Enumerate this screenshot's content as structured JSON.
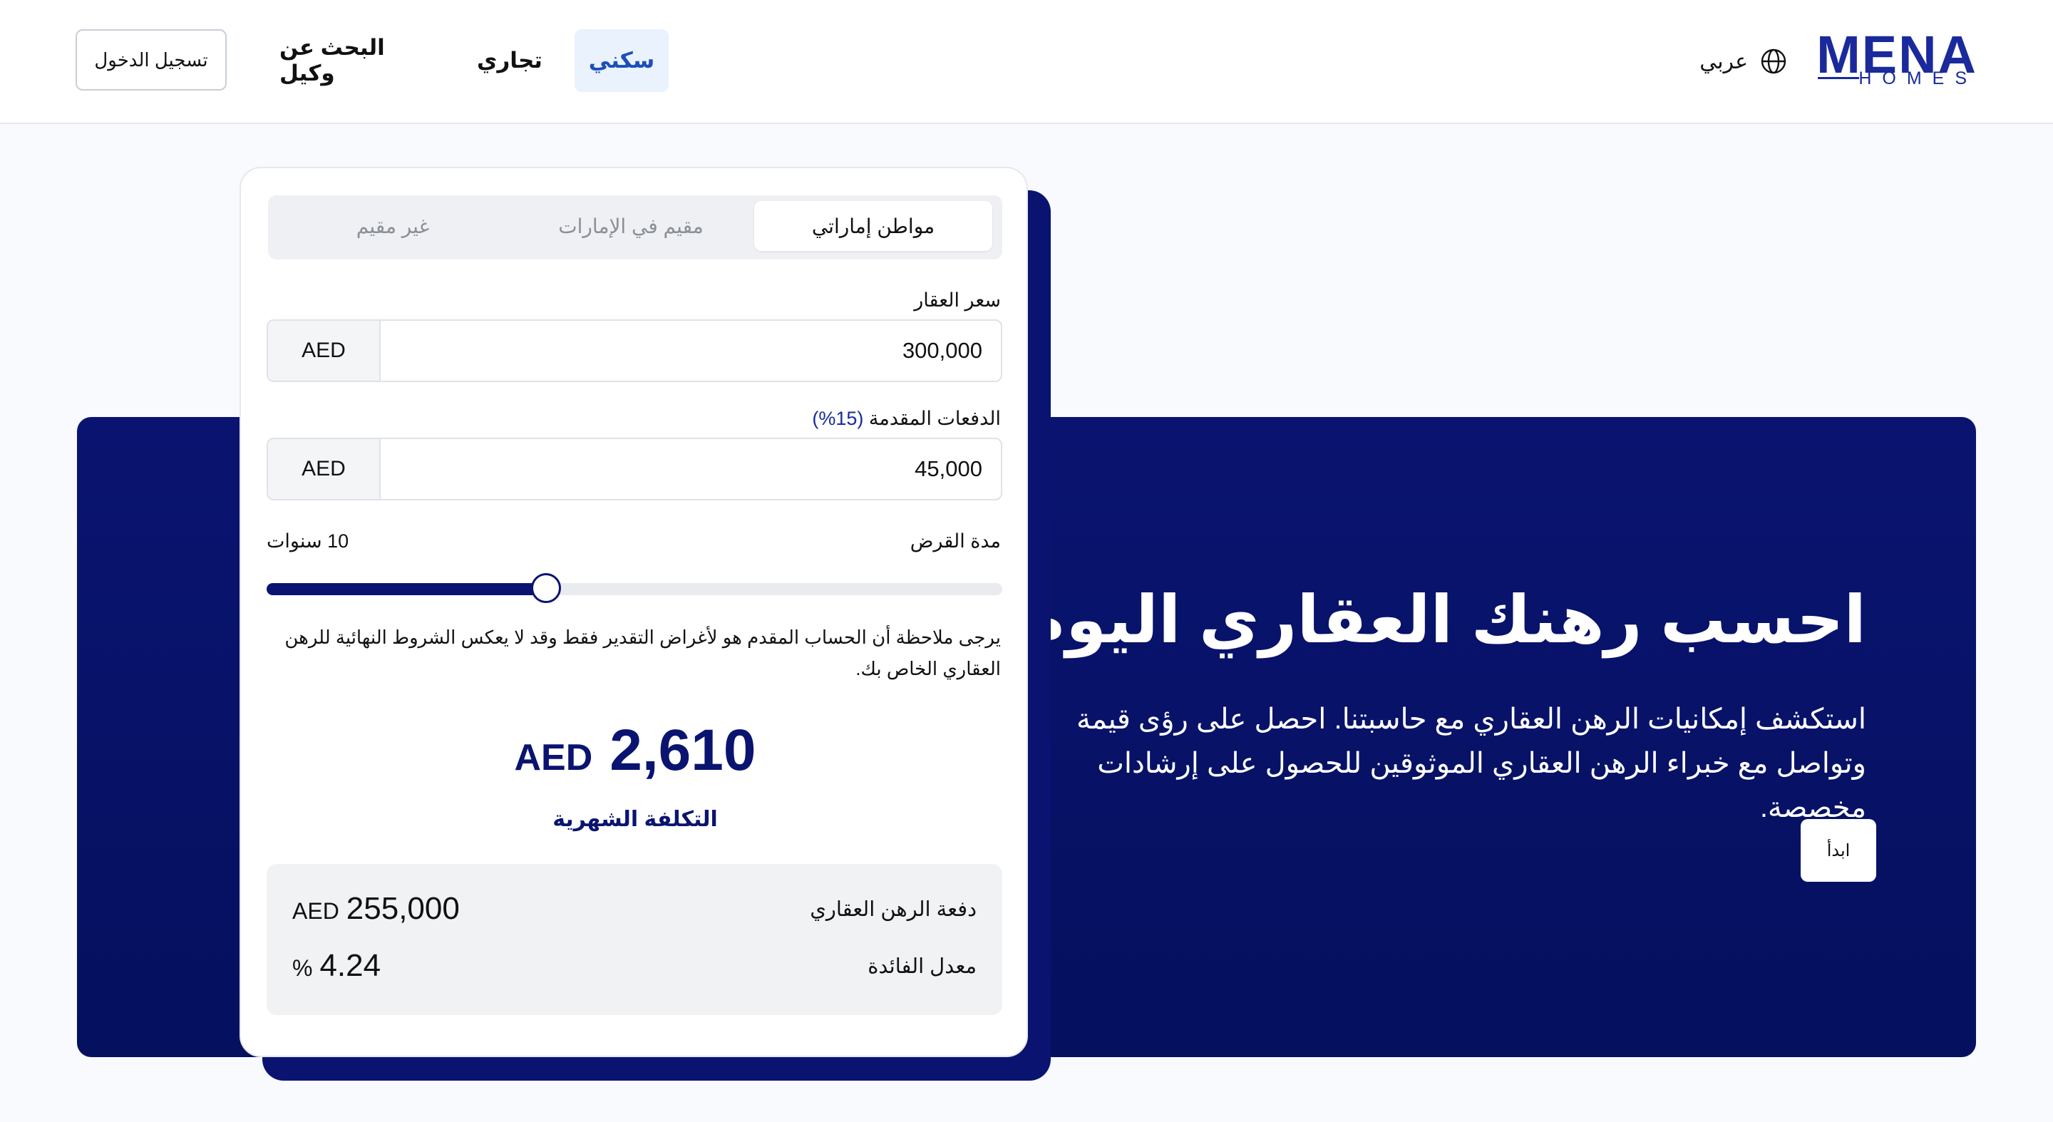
{
  "header": {
    "logo_main": "MENA",
    "logo_sub": "HOMES",
    "language_label": "عربي",
    "nav": {
      "residential": "سكني",
      "commercial": "تجاري",
      "find_agent": "البحث عن وكيل"
    },
    "login_label": "تسجيل الدخول"
  },
  "hero": {
    "title": "احسب رهنك العقاري اليوم",
    "description": "استكشف إمكانيات الرهن العقاري مع حاسبتنا. احصل على رؤى قيمة وتواصل مع خبراء الرهن العقاري الموثوقين للحصول على إرشادات مخصصة.",
    "start_label": "ابدأ"
  },
  "calculator": {
    "residency_tabs": [
      {
        "label": "مواطن إماراتي",
        "active": true
      },
      {
        "label": "مقيم في الإمارات",
        "active": false
      },
      {
        "label": "غير مقيم",
        "active": false
      }
    ],
    "property_price": {
      "label": "سعر العقار",
      "value": "300,000",
      "currency": "AED"
    },
    "down_payment": {
      "label": "الدفعات المقدمة",
      "percent": "(15%)",
      "value": "45,000",
      "currency": "AED"
    },
    "loan_term": {
      "label": "مدة القرض",
      "value_text": "10 سنوات",
      "slider_fraction": 0.38
    },
    "note": "يرجى ملاحظة أن الحساب المقدم هو لأغراض التقدير فقط وقد لا يعكس الشروط النهائية للرهن العقاري الخاص بك.",
    "monthly": {
      "currency": "AED",
      "amount": "2,610",
      "label": "التكلفة الشهرية"
    },
    "summary": {
      "mortgage_payment": {
        "label": "دفعة الرهن العقاري",
        "value": "255,000",
        "currency": "AED"
      },
      "interest_rate": {
        "label": "معدل الفائدة",
        "value": "4.24",
        "unit": "%"
      }
    }
  },
  "colors": {
    "navy": "#0a1470",
    "brand_blue": "#1a2a9c",
    "active_tab_bg": "#e9f2fd",
    "active_tab_text": "#1d4fb8"
  },
  "icons": {
    "language": "globe-icon"
  }
}
